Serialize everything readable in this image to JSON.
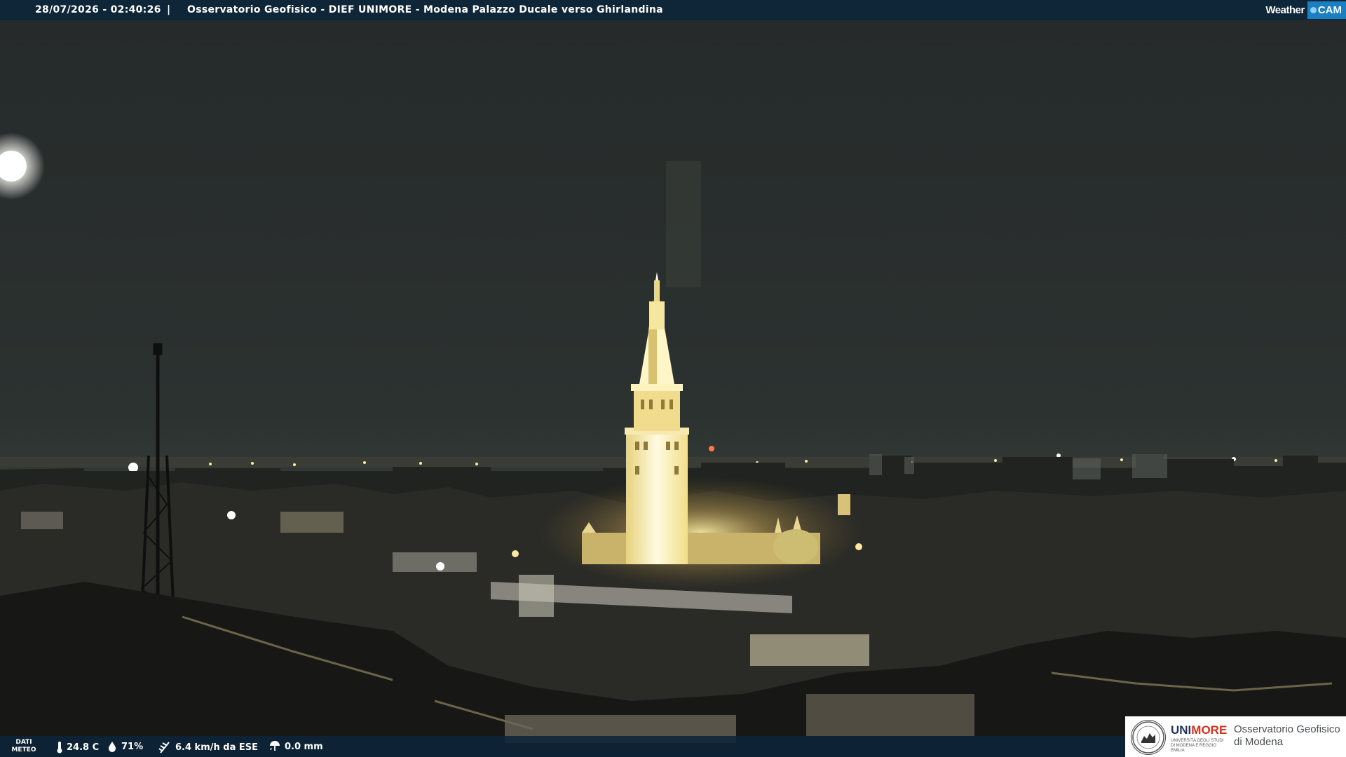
{
  "header": {
    "datetime": "28/07/2026 - 02:40:26",
    "separator": "|",
    "title": "Osservatorio Geofisico - DIEF UNIMORE - Modena Palazzo Ducale verso Ghirlandina",
    "brand_weather": "Weather",
    "brand_cam": "CAM"
  },
  "meteo": {
    "label_line1": "DATI",
    "label_line2": "METEO",
    "temperature": "24.8 C",
    "humidity": "71%",
    "wind": "6.4 km/h da ESE",
    "rain": "0.0 mm"
  },
  "logo": {
    "uni_part1": "UNI",
    "uni_part2": "MORE",
    "uni_sub": "UNIVERSITÀ DEGLI STUDI DI MODENA E REGGIO EMILIA",
    "observatory_line1": "Osservatorio Geofisico",
    "observatory_line2": "di Modena"
  },
  "colors": {
    "bar": "#0c243a",
    "brand_blue": "#1b7fc4",
    "unimore_red": "#d3331e",
    "unimore_navy": "#22355f"
  },
  "icons": [
    "thermometer-icon",
    "humidity-drop-icon",
    "wind-icon",
    "rain-gauge-icon"
  ]
}
